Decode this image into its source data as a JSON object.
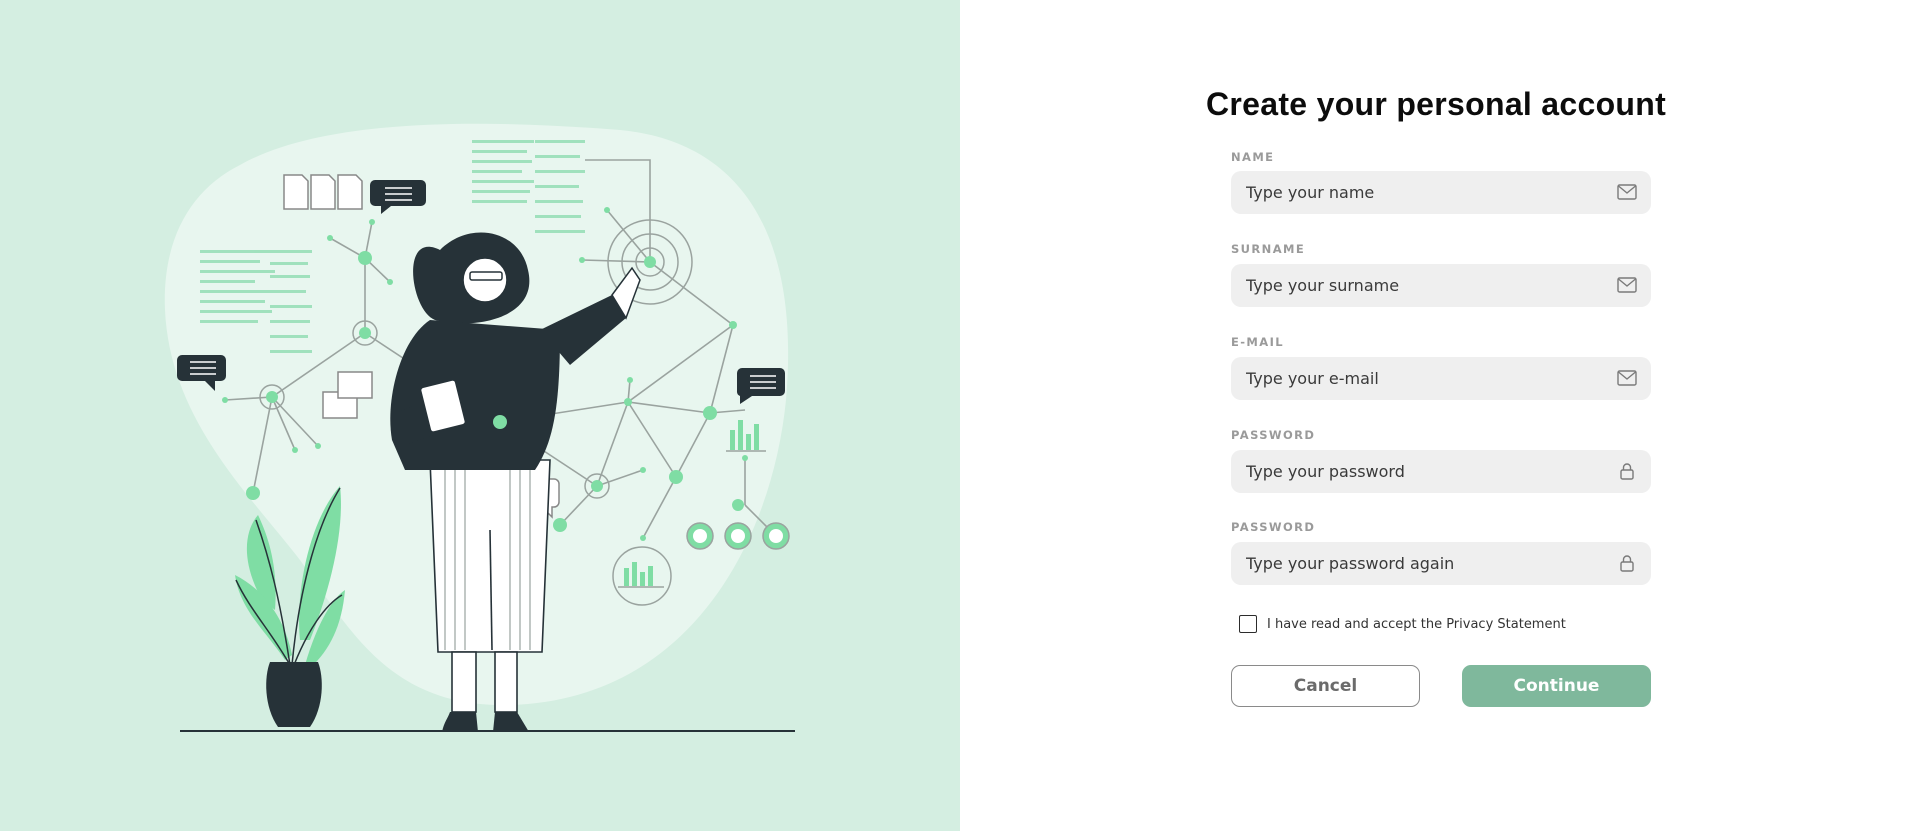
{
  "form": {
    "title": "Create your personal account",
    "fields": [
      {
        "label": "NAME",
        "placeholder": "Type your name",
        "value": "",
        "icon": "mail-icon"
      },
      {
        "label": "SURNAME",
        "placeholder": "Type your surname",
        "value": "",
        "icon": "mail-icon"
      },
      {
        "label": "E-MAIL",
        "placeholder": "Type your e-mail",
        "value": "",
        "icon": "mail-icon"
      },
      {
        "label": "PASSWORD",
        "placeholder": "Type your password",
        "value": "",
        "icon": "lock-icon"
      },
      {
        "label": "PASSWORD",
        "placeholder": "Type your password again",
        "value": "",
        "icon": "lock-icon"
      }
    ],
    "privacy": {
      "label": "I have read and accept the Privacy Statement",
      "checked": false
    },
    "cancel_label": "Cancel",
    "continue_label": "Continue"
  },
  "colors": {
    "illustration_background": "#d4eee1",
    "accent_green": "#7fb89c",
    "input_background": "#efefef",
    "dark": "#263238"
  }
}
